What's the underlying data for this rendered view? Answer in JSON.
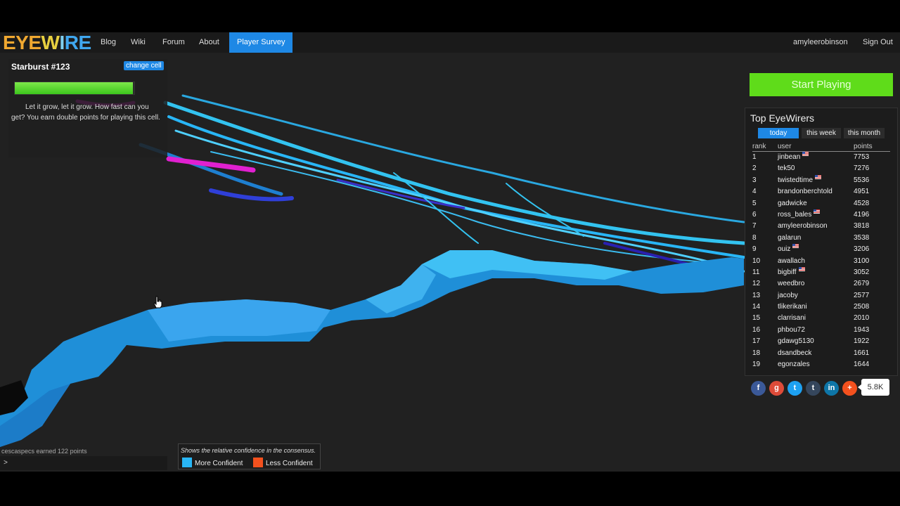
{
  "nav": {
    "logo": {
      "p1": "EYE",
      "p2": "W",
      "p3": "I",
      "p4": "RE"
    },
    "links": [
      "Blog",
      "Wiki",
      "Forum",
      "About",
      "Player Survey"
    ],
    "username": "amyleerobinson",
    "signout": "Sign Out"
  },
  "cell": {
    "title": "Starburst #123",
    "change_label": "change cell",
    "progress": 0.99,
    "description": "Let it grow, let it grow. How fast can you get? You earn double points for playing this cell."
  },
  "start_button": "Start Playing",
  "leaderboard": {
    "title": "Top EyeWirers",
    "tabs": [
      "today",
      "this week",
      "this month"
    ],
    "active_tab": "today",
    "columns": [
      "rank",
      "user",
      "points"
    ],
    "rows": [
      {
        "rank": "1",
        "user": "jinbean",
        "points": "7753",
        "flag": true
      },
      {
        "rank": "2",
        "user": "tek50",
        "points": "7276",
        "flag": false
      },
      {
        "rank": "3",
        "user": "twistedtime",
        "points": "5536",
        "flag": true
      },
      {
        "rank": "4",
        "user": "brandonberchtold",
        "points": "4951",
        "flag": false
      },
      {
        "rank": "5",
        "user": "gadwicke",
        "points": "4528",
        "flag": false
      },
      {
        "rank": "6",
        "user": "ross_bales",
        "points": "4196",
        "flag": true
      },
      {
        "rank": "7",
        "user": "amyleerobinson",
        "points": "3818",
        "flag": false
      },
      {
        "rank": "8",
        "user": "galarun",
        "points": "3538",
        "flag": false
      },
      {
        "rank": "9",
        "user": "ouiz",
        "points": "3206",
        "flag": true
      },
      {
        "rank": "10",
        "user": "awallach",
        "points": "3100",
        "flag": false
      },
      {
        "rank": "11",
        "user": "bigbiff",
        "points": "3052",
        "flag": true
      },
      {
        "rank": "12",
        "user": "weedbro",
        "points": "2679",
        "flag": false
      },
      {
        "rank": "13",
        "user": "jacoby",
        "points": "2577",
        "flag": false
      },
      {
        "rank": "14",
        "user": "tlikerikani",
        "points": "2508",
        "flag": false
      },
      {
        "rank": "15",
        "user": "clarrisani",
        "points": "2010",
        "flag": false
      },
      {
        "rank": "16",
        "user": "phbou72",
        "points": "1943",
        "flag": false
      },
      {
        "rank": "17",
        "user": "gdawg5130",
        "points": "1922",
        "flag": false
      },
      {
        "rank": "18",
        "user": "dsandbeck",
        "points": "1661",
        "flag": false
      },
      {
        "rank": "19",
        "user": "egonzales",
        "points": "1644",
        "flag": false
      }
    ]
  },
  "social": {
    "buttons": [
      {
        "icon": "facebook-icon",
        "glyph": "f",
        "color": "#3b5998"
      },
      {
        "icon": "google-plus-icon",
        "glyph": "g",
        "color": "#dd4b39"
      },
      {
        "icon": "twitter-icon",
        "glyph": "t",
        "color": "#1da1f2"
      },
      {
        "icon": "tumblr-icon",
        "glyph": "t",
        "color": "#35465c"
      },
      {
        "icon": "linkedin-icon",
        "glyph": "in",
        "color": "#0e76a8"
      },
      {
        "icon": "share-plus-icon",
        "glyph": "+",
        "color": "#f4511e"
      }
    ],
    "count": "5.8K"
  },
  "chat": {
    "message": "cescaspecs earned 122 points",
    "prompt": ">"
  },
  "legend": {
    "note": "Shows the relative confidence in the consensus.",
    "more": "More Confident",
    "less": "Less Confident",
    "more_color": "#29b6f6",
    "less_color": "#f4511e"
  }
}
